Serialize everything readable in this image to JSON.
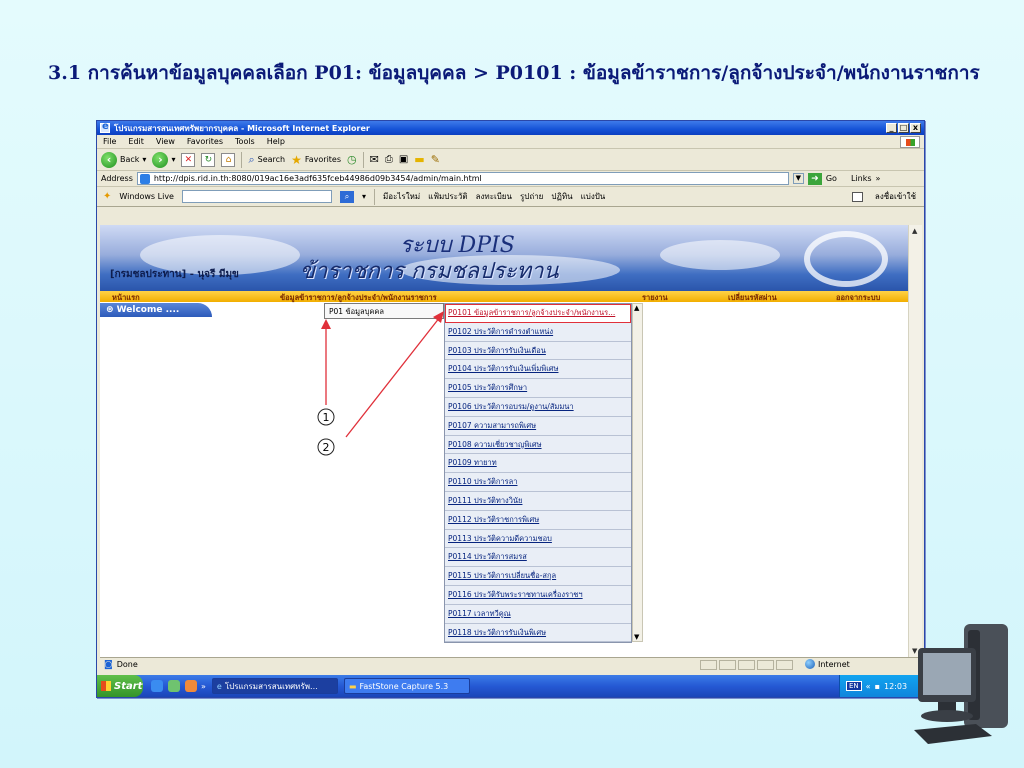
{
  "slide": {
    "title": "3.1 การค้นหาข้อมูลบุคคลเลือก P01: ข้อมูลบุคคล > P0101 : ข้อมูลข้าราชการ/ลูกจ้างประจำ/พนักงานราชการ"
  },
  "window": {
    "title": "โปรแกรมสารสนเทศทรัพยากรบุคคล - Microsoft Internet Explorer",
    "buttons": [
      "_",
      "□",
      "x"
    ]
  },
  "menubar": [
    "File",
    "Edit",
    "View",
    "Favorites",
    "Tools",
    "Help"
  ],
  "toolbar": {
    "back": "Back",
    "search": "Search",
    "favorites": "Favorites"
  },
  "addressbar": {
    "label": "Address",
    "url": "http://dpis.rid.in.th:8080/019ac16e3adf635fceb44986d09b3454/admin/main.html",
    "go": "Go",
    "links": "Links"
  },
  "linksbar": {
    "windows_live": "Windows Live",
    "items": [
      "มีอะไรใหม่",
      "แฟ้มประวัติ",
      "ลงทะเบียน",
      "รูปถ่าย",
      "ปฏิทิน",
      "แบ่งปัน"
    ],
    "sign_in": "ลงชื่อเข้าใช้"
  },
  "banner": {
    "brand": "ระบบ DPIS",
    "subbrand": "ข้าราชการ กรมชลประทาน",
    "user": "[กรมชลประทาน] - นุจรี มีมุข"
  },
  "topnav": {
    "home": "หน้าแรก",
    "personnel": "ข้อมูลข้าราชการ/ลูกจ้างประจำ/พนักงานราชการ",
    "report": "รายงาน",
    "change_password": "เปลี่ยนรหัสผ่าน",
    "logout": "ออกจากระบบ"
  },
  "welcome": "⊛ Welcome ....",
  "p01_menu": "P01 ข้อมูลบุคคล",
  "submenu": [
    "P0101 ข้อมูลข้าราชการ/ลูกจ้างประจำ/พนักงานร...",
    "P0102 ประวัติการดำรงตำแหน่ง",
    "P0103 ประวัติการรับเงินเดือน",
    "P0104 ประวัติการรับเงินเพิ่มพิเศษ",
    "P0105 ประวัติการศึกษา",
    "P0106 ประวัติการอบรม/ดูงาน/สัมมนา",
    "P0107 ความสามารถพิเศษ",
    "P0108 ความเชี่ยวชาญพิเศษ",
    "P0109 ทายาท",
    "P0110 ประวัติการลา",
    "P0111 ประวัติทางวินัย",
    "P0112 ประวัติราชการพิเศษ",
    "P0113 ประวัติความดีความชอบ",
    "P0114 ประวัติการสมรส",
    "P0115 ประวัติการเปลี่ยนชื่อ-สกุล",
    "P0116 ประวัติรับพระราชทานเครื่องราชฯ",
    "P0117 เวลาทวีคูณ",
    "P0118 ประวัติการรับเงินพิเศษ"
  ],
  "annotations": {
    "one": "1",
    "two": "2",
    "arrow_color": "#e0303a"
  },
  "statusbar": {
    "text": "Done",
    "zone": "Internet"
  },
  "taskbar": {
    "start": "Start",
    "task1": "โปรแกรมสารสนเทศทรัพ...",
    "task2": "FastStone Capture 5.3",
    "lang": "EN",
    "clock": "12:03"
  },
  "colors": {
    "title": "#0b1a78",
    "nav_bar": "#f2ae00",
    "highlight": "#e0303a",
    "link": "#06247f"
  }
}
